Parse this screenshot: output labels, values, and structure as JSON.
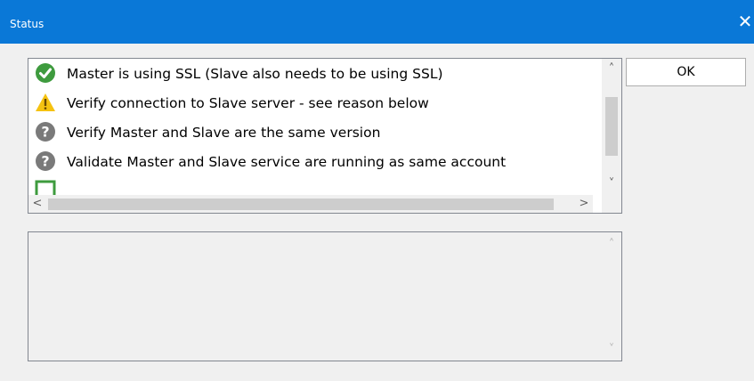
{
  "window": {
    "title": "Status",
    "close_glyph": "✕"
  },
  "checklist": {
    "items": [
      {
        "label": "Master is using SSL (Slave also needs to be using SSL)",
        "status": "success",
        "icon": "green-check-icon"
      },
      {
        "label": "Verify connection to Slave server - see reason below",
        "status": "warning",
        "icon": "warning-triangle-icon"
      },
      {
        "label": "Verify Master and Slave are the same version",
        "status": "unknown",
        "icon": "question-mark-icon"
      },
      {
        "label": "Validate Master and Slave service are running as same account",
        "status": "unknown",
        "icon": "question-mark-icon"
      },
      {
        "label": "",
        "status": "pending",
        "icon": "empty-checkbox-icon"
      }
    ],
    "scroll_up_glyph": "˄",
    "scroll_down_glyph": "˅",
    "scroll_left_glyph": "<",
    "scroll_right_glyph": ">"
  },
  "details": {
    "text": "",
    "scroll_up_glyph": "˄",
    "scroll_down_glyph": "˅"
  },
  "buttons": {
    "ok_label": "OK"
  },
  "colors": {
    "titlebar": "#0a78d7",
    "success": "#3e9b3e",
    "warning": "#f5c211",
    "unknown": "#7a7a7a"
  }
}
